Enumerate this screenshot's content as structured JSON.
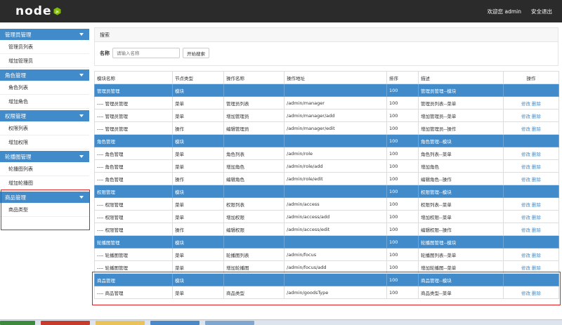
{
  "header": {
    "logo_text": "node",
    "welcome": "欢迎您 admin",
    "logout": "安全退出"
  },
  "sidebar": {
    "groups": [
      {
        "label": "管理员管理",
        "items": [
          "管理员列表",
          "增加管理员"
        ]
      },
      {
        "label": "角色管理",
        "items": [
          "角色列表",
          "增加角色"
        ]
      },
      {
        "label": "权限管理",
        "items": [
          "权限列表",
          "增加权限"
        ]
      },
      {
        "label": "轮播图管理",
        "items": [
          "轮播图列表",
          "增加轮播图"
        ]
      },
      {
        "label": "商品管理",
        "items": [
          "商品类型"
        ]
      }
    ]
  },
  "search": {
    "panel_title": "搜索",
    "name_label": "名称",
    "placeholder": "请输入名称",
    "button": "开始搜索"
  },
  "table": {
    "headers": [
      "模块名称",
      "节点类型",
      "操作名称",
      "操作地址",
      "排序",
      "描述",
      "操作"
    ],
    "edit_label": "修改",
    "delete_label": "删除",
    "rows": [
      {
        "group": true,
        "name": "管理员管理",
        "type": "模块",
        "action": "",
        "url": "",
        "sort": "100",
        "desc": "管理员管理--模块"
      },
      {
        "group": false,
        "name": "---- 管理员管理",
        "type": "菜单",
        "action": "管理员列表",
        "url": "/admin/manager",
        "sort": "100",
        "desc": "管理员列表--菜单"
      },
      {
        "group": false,
        "name": "---- 管理员管理",
        "type": "菜单",
        "action": "增加管理员",
        "url": "/admin/manager/add",
        "sort": "100",
        "desc": "增加管理员--菜单"
      },
      {
        "group": false,
        "name": "---- 管理员管理",
        "type": "操作",
        "action": "编辑管理员",
        "url": "/admin/manager/edit",
        "sort": "100",
        "desc": "增加管理员--操作"
      },
      {
        "group": true,
        "name": "角色管理",
        "type": "模块",
        "action": "",
        "url": "",
        "sort": "100",
        "desc": "角色管理--模块"
      },
      {
        "group": false,
        "name": "---- 角色管理",
        "type": "菜单",
        "action": "角色列表",
        "url": "/admin/role",
        "sort": "100",
        "desc": "角色列表--菜单"
      },
      {
        "group": false,
        "name": "---- 角色管理",
        "type": "菜单",
        "action": "增加角色",
        "url": "/admin/role/add",
        "sort": "100",
        "desc": "增加角色"
      },
      {
        "group": false,
        "name": "---- 角色管理",
        "type": "操作",
        "action": "编辑角色",
        "url": "/admin/role/edit",
        "sort": "100",
        "desc": "编辑角色--操作"
      },
      {
        "group": true,
        "name": "权限管理",
        "type": "模块",
        "action": "",
        "url": "",
        "sort": "100",
        "desc": "权限管理--模块"
      },
      {
        "group": false,
        "name": "---- 权限管理",
        "type": "菜单",
        "action": "权限列表",
        "url": "/admin/access",
        "sort": "100",
        "desc": "权限列表--菜单"
      },
      {
        "group": false,
        "name": "---- 权限管理",
        "type": "菜单",
        "action": "增加权限",
        "url": "/admin/access/add",
        "sort": "100",
        "desc": "增加权限--菜单"
      },
      {
        "group": false,
        "name": "---- 权限管理",
        "type": "操作",
        "action": "编辑权限",
        "url": "/admin/access/edit",
        "sort": "100",
        "desc": "编辑权限--操作"
      },
      {
        "group": true,
        "name": "轮播图管理",
        "type": "模块",
        "action": "",
        "url": "",
        "sort": "100",
        "desc": "轮播图管理--模块"
      },
      {
        "group": false,
        "name": "---- 轮播图管理",
        "type": "菜单",
        "action": "轮播图列表",
        "url": "/admin/focus",
        "sort": "100",
        "desc": "轮播图列表--菜单"
      },
      {
        "group": false,
        "name": "---- 轮播图管理",
        "type": "菜单",
        "action": "增加轮播图",
        "url": "/admin/focus/add",
        "sort": "100",
        "desc": "增加轮播图--菜单"
      },
      {
        "group": true,
        "name": "商品管理",
        "type": "模块",
        "action": "",
        "url": "",
        "sort": "100",
        "desc": "商品管理--模块"
      },
      {
        "group": false,
        "name": "---- 商品管理",
        "type": "菜单",
        "action": "商品类型",
        "url": "/admin/goodsType",
        "sort": "100",
        "desc": "商品类型--菜单"
      }
    ]
  },
  "colors": {
    "header_bg": "#2b2b2b",
    "accent": "#428bca",
    "highlight": "#e02020",
    "logo_green": "#80bd01"
  }
}
